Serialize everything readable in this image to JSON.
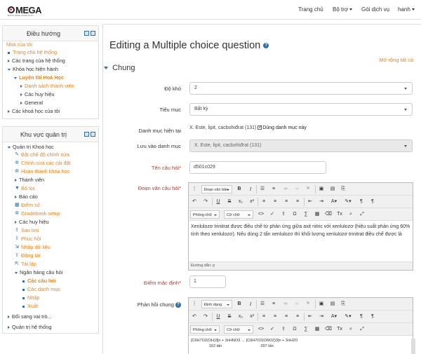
{
  "logo": {
    "text": "MEGA",
    "subtitle": "ĐỒNG HÀNH CÙNG SĨ TỬ"
  },
  "topnav": {
    "home": "Trang chủ",
    "tools": "Bộ trợ",
    "services": "Gói dịch vụ",
    "user": "hanh"
  },
  "nav_block": {
    "title": "Điều hướng",
    "items": [
      "Nhà của tôi",
      "Trang chủ hệ thống",
      "Các trang của hệ thống",
      "Khóa học hiện hành",
      "Luyện thi Hoá Học",
      "Danh sách thành viên",
      "Các huy hiệu",
      "General",
      "Các khoá học của tôi"
    ]
  },
  "admin_block": {
    "title": "Khu vực quản trị",
    "items": [
      "Quản trị Khoá học",
      "Bật chế độ chỉnh sửa",
      "Chỉnh sửa các cài đặt",
      "Hoàn thành khóa học",
      "Thành viên",
      "Bộ lọc",
      "Báo cáo",
      "Điểm số",
      "Gradebook setup",
      "Các huy hiệu",
      "Sao lưu",
      "Phục hồi",
      "Nhập dữ liệu",
      "Đăng tải",
      "Tái lập",
      "Ngân hàng câu hỏi",
      "Các câu hỏi",
      "Các danh mục",
      "Nhập",
      "Xuất",
      "Đổi sang vai trò...",
      "Quản trị hệ thống"
    ]
  },
  "page": {
    "title": "Editing a Multiple choice question",
    "expand_all": "Mở rộng tất cả",
    "section": "Chung"
  },
  "form": {
    "difficulty_label": "Độ khó",
    "difficulty_value": "2",
    "subsection_label": "Tiểu mục",
    "subsection_value": "Bất kỳ",
    "current_category_label": "Danh mục hiện tại",
    "current_category_value": "X. Este, lipit, cacbohiđrat (131)",
    "use_category_label": "Dùng danh mục này",
    "save_in_label": "Lưu vào danh mục",
    "save_in_value": "X. Este, lipit, cacbohiđrat (131)",
    "name_label": "Tên câu hỏi",
    "name_value": "d501c029",
    "text_label": "Đoạn văn câu hỏi",
    "question_text": "Xenlulozơ trinitrat được điều chế từ phản ứng giữa axit nitric với xenlulozơ (hiệu suất phản ứng 60% tính theo xenlulozơ). Nếu dùng 2 tấn xenlulozơ thì khối lượng xenlulozơ trinitrat điều chế được là",
    "path_label": "Đường dẫn: p",
    "mark_label": "Điểm mặc định",
    "mark_value": "1",
    "feedback_label": "Phản hồi chung",
    "toolbar": {
      "paragraph": "Đoạn văn bản",
      "format": "Định dạng",
      "font": "Phông chữ",
      "size": "Cỡ chữ"
    },
    "formula": "[C6H7O2(OH)3]n + 3nHNO3 → [C6H7O2(ONO2)3]n + 3nH2O",
    "formula_mass_1": "162 tấn",
    "formula_mass_2": "297 tấn"
  }
}
